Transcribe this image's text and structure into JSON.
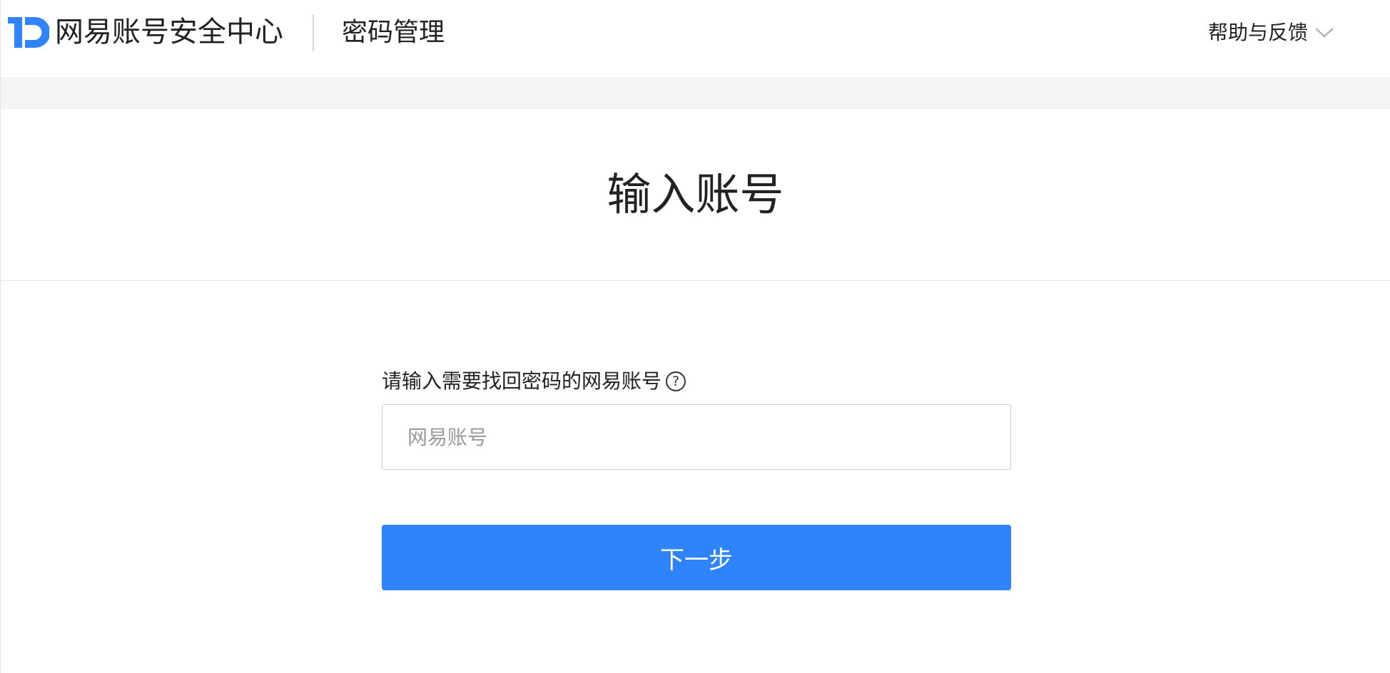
{
  "header": {
    "brand": "网易账号安全中心",
    "subtitle": "密码管理",
    "help_label": "帮助与反馈",
    "logo_icon": "netease-id-logo-icon",
    "chevron_icon": "chevron-down-icon"
  },
  "main": {
    "title": "输入账号"
  },
  "form": {
    "label": "请输入需要找回密码的网易账号",
    "help_icon": "question-circle-icon",
    "help_glyph": "?",
    "account_placeholder": "网易账号",
    "account_value": "",
    "submit_label": "下一步"
  },
  "colors": {
    "accent": "#2f84fc",
    "logo_blue": "#2f84fc",
    "band_gray": "#f4f4f4"
  }
}
